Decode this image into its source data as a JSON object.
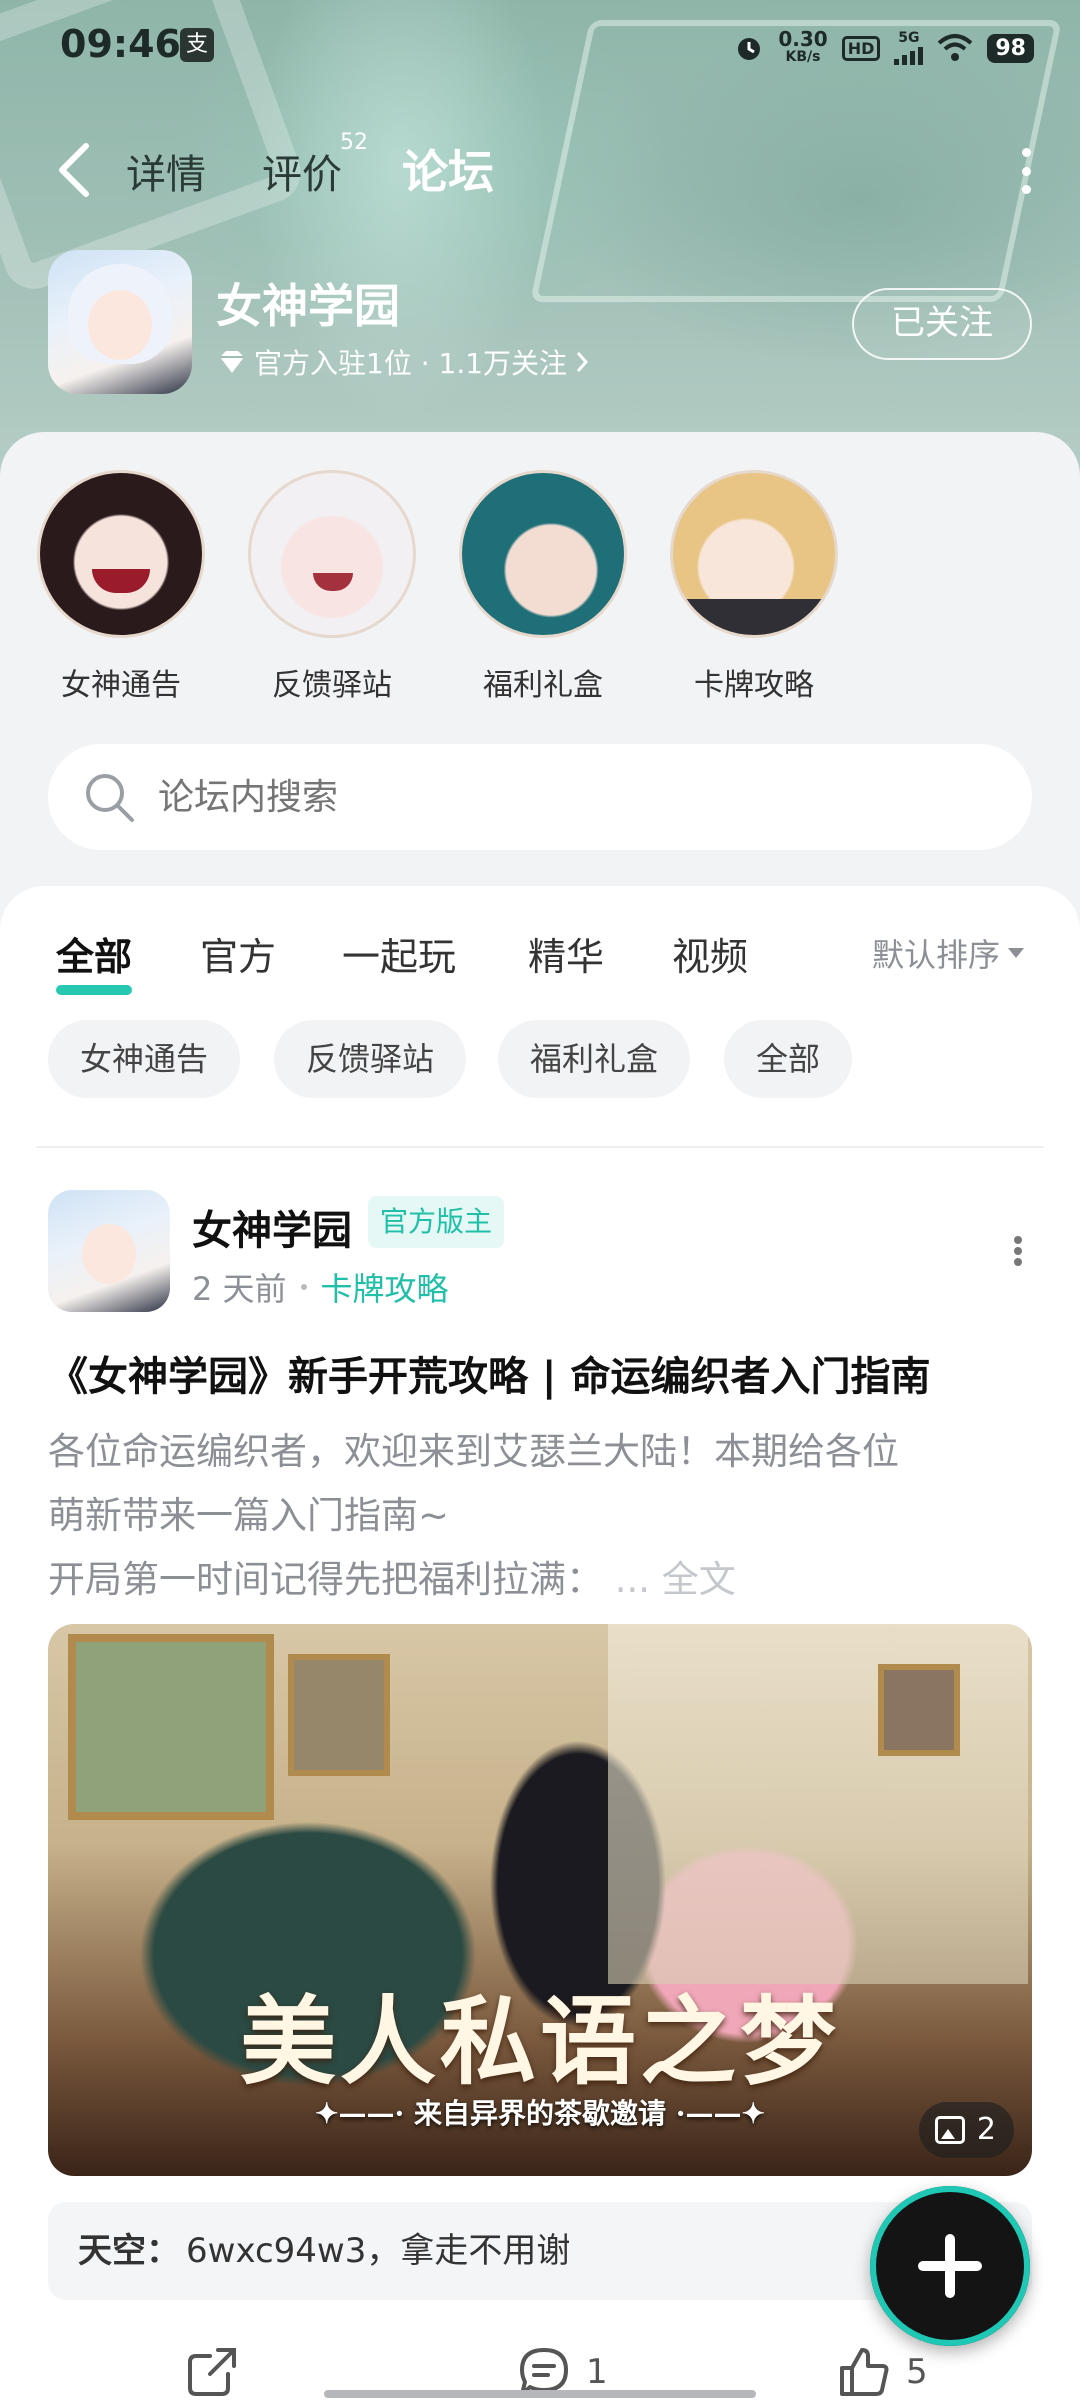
{
  "status_bar": {
    "time": "09:46",
    "carrier_glyph": "支",
    "net_speed_value": "0.30",
    "net_speed_unit": "KB/s",
    "hd": "HD",
    "network": "5G",
    "battery": "98"
  },
  "nav": {
    "tabs": [
      {
        "label": "详情"
      },
      {
        "label": "评价",
        "badge": "52"
      },
      {
        "label": "论坛"
      }
    ],
    "active_tab": "论坛"
  },
  "game": {
    "name": "女神学园",
    "meta": "官方入驻1位 · 1.1万关注",
    "follow_label": "已关注"
  },
  "sections": [
    {
      "label": "女神通告"
    },
    {
      "label": "反馈驿站"
    },
    {
      "label": "福利礼盒"
    },
    {
      "label": "卡牌攻略"
    }
  ],
  "search": {
    "placeholder": "论坛内搜索"
  },
  "feed": {
    "tabs": [
      "全部",
      "官方",
      "一起玩",
      "精华",
      "视频"
    ],
    "active_tab": "全部",
    "sort_label": "默认排序",
    "chips": [
      "女神通告",
      "反馈驿站",
      "福利礼盒",
      "全部"
    ]
  },
  "post": {
    "author": "女神学园",
    "badge": "官方版主",
    "time": "2 天前",
    "category": "卡牌攻略",
    "title": "《女神学园》新手开荒攻略 | 命运编织者入门指南",
    "body_line1": "各位命运编织者，欢迎来到艾瑟兰大陆！本期给各位",
    "body_line2": "萌新带来一篇入门指南~",
    "body_line3": "开局第一时间记得先把福利拉满：",
    "more_label": "... 全文",
    "image_title": "美人私语之梦",
    "image_subtitle": "✦——· 来自异界的茶歇邀请 ·——✦",
    "image_count": "2",
    "comment_user": "天空：",
    "comment_text": "6wxc94w3，拿走不用谢",
    "comment_count": "1",
    "like_count": "5"
  },
  "colors": {
    "accent": "#27c8b2",
    "header_bg": "#9fbfb5"
  }
}
